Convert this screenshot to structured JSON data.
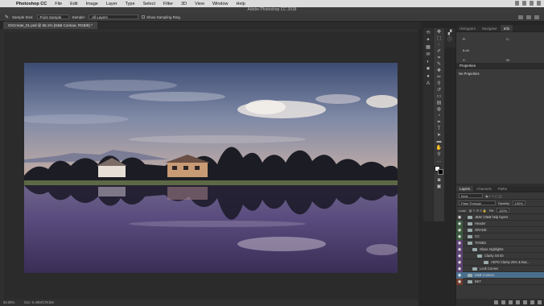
{
  "menubar": {
    "app_name": "Photoshop CC",
    "items": [
      "File",
      "Edit",
      "Image",
      "Layer",
      "Type",
      "Select",
      "Filter",
      "3D",
      "View",
      "Window",
      "Help"
    ]
  },
  "window_title": "Adobe Photoshop CC 2018",
  "options": {
    "sample_size_label": "Sample Size:",
    "sample_size_value": "Point Sample",
    "sample_label": "Sample:",
    "sample_value": "All Layers",
    "show_ring_label": "Show Sampling Ring"
  },
  "document": {
    "tab_label": "OnCreate_01.psd @ 56.1% (D&B Contour, RGB/8) *"
  },
  "status": {
    "zoom": "56.05%",
    "doc": "Doc: 5.49M/178.5M"
  },
  "top_panel": {
    "tabs": [
      "Histogram",
      "Navigator",
      "Info"
    ],
    "active_tab": "Info",
    "info_rgb_label": "R:",
    "info_cmyk_label": "C:",
    "info_bits": "8-bit",
    "info_x": "X:",
    "info_w": "W:"
  },
  "properties": {
    "title": "Properties",
    "empty_text": "No Properties"
  },
  "layers": {
    "tabs": [
      "Layers",
      "Channels",
      "Paths"
    ],
    "active_tab": "Layers",
    "kind_label": "Kind",
    "blend_mode": "Pass Through",
    "opacity_label": "Opacity:",
    "opacity_value": "100%",
    "lock_label": "Lock:",
    "fill_label": "Fill:",
    "fill_value": "100%",
    "rows": [
      {
        "name": "J&W | D&B help layers",
        "color": "#3a3a3a"
      },
      {
        "name": "Header",
        "color": "#3b5a3f"
      },
      {
        "name": "GRADE",
        "color": "#3b5a3f"
      },
      {
        "name": "CC",
        "color": "#3b5a3f"
      },
      {
        "name": "TONES",
        "color": "#5b4270"
      },
      {
        "name": "Glass Highlights",
        "color": "#5b4270"
      },
      {
        "name": "Clarity init 50",
        "color": "#5b4270"
      },
      {
        "name": "AEFD Clarity 25% & Bac...",
        "color": "#5b4270"
      },
      {
        "name": "Look Curves",
        "color": "#5b4270"
      },
      {
        "name": "D&B Contour",
        "color": "#4a6f8e",
        "selected": true
      },
      {
        "name": "BKT",
        "color": "#6e3a2a"
      }
    ]
  },
  "colors": {
    "sky_top": "#3d4c73",
    "sky_mid": "#8a93ad",
    "horizon": "#c09a7a",
    "water": "#4a3a6a"
  }
}
